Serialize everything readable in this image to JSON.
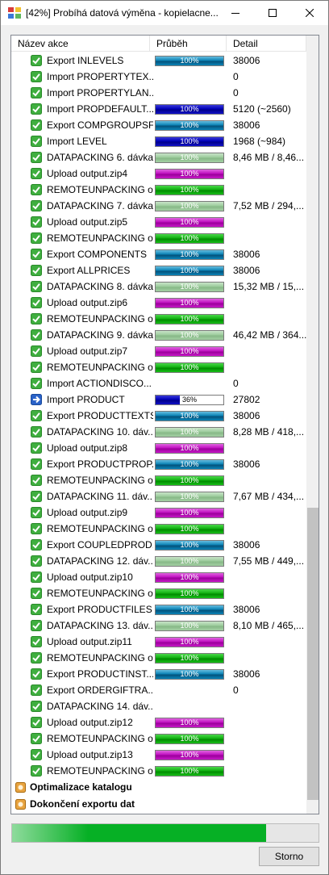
{
  "window": {
    "title": "[42%] Probíhá datová výměna - kopielacne..."
  },
  "columns": {
    "name": "Název akce",
    "progress": "Průběh",
    "detail": "Detail"
  },
  "rows": [
    {
      "name": "Export INLEVELS",
      "status": "done",
      "bar": {
        "pct": 1.0,
        "label": "100%",
        "color": "blue"
      },
      "detail": "38006"
    },
    {
      "name": "Import  PROPERTYTEX...",
      "status": "done",
      "bar": null,
      "detail": "0"
    },
    {
      "name": "Import PROPERTYLAN...",
      "status": "done",
      "bar": null,
      "detail": "0"
    },
    {
      "name": "Import PROPDEFAULT...",
      "status": "done",
      "bar": {
        "pct": 1.0,
        "label": "100%",
        "color": "navy"
      },
      "detail": "5120 (~2560)"
    },
    {
      "name": "Export COMPGROUPSF...",
      "status": "done",
      "bar": {
        "pct": 1.0,
        "label": "100%",
        "color": "blue"
      },
      "detail": "38006"
    },
    {
      "name": "Import LEVEL",
      "status": "done",
      "bar": {
        "pct": 1.0,
        "label": "100%",
        "color": "navy"
      },
      "detail": "1968 (~984)"
    },
    {
      "name": "DATAPACKING 6. dávka",
      "status": "done",
      "bar": {
        "pct": 1.0,
        "label": "100%",
        "color": "sage"
      },
      "detail": "8,46 MB / 8,46..."
    },
    {
      "name": "Upload output.zip4",
      "status": "done",
      "bar": {
        "pct": 1.0,
        "label": "100%",
        "color": "magenta"
      },
      "detail": ""
    },
    {
      "name": "REMOTEUNPACKING o...",
      "status": "done",
      "bar": {
        "pct": 1.0,
        "label": "100%",
        "color": "green"
      },
      "detail": ""
    },
    {
      "name": "DATAPACKING 7. dávka",
      "status": "done",
      "bar": {
        "pct": 1.0,
        "label": "100%",
        "color": "sage"
      },
      "detail": "7,52 MB / 294,..."
    },
    {
      "name": "Upload output.zip5",
      "status": "done",
      "bar": {
        "pct": 1.0,
        "label": "100%",
        "color": "magenta"
      },
      "detail": ""
    },
    {
      "name": "REMOTEUNPACKING o...",
      "status": "done",
      "bar": {
        "pct": 1.0,
        "label": "100%",
        "color": "green"
      },
      "detail": ""
    },
    {
      "name": "Export COMPONENTS",
      "status": "done",
      "bar": {
        "pct": 1.0,
        "label": "100%",
        "color": "blue"
      },
      "detail": "38006"
    },
    {
      "name": "Export ALLPRICES",
      "status": "done",
      "bar": {
        "pct": 1.0,
        "label": "100%",
        "color": "blue"
      },
      "detail": "38006"
    },
    {
      "name": "DATAPACKING 8. dávka",
      "status": "done",
      "bar": {
        "pct": 1.0,
        "label": "100%",
        "color": "sage"
      },
      "detail": "15,32 MB / 15,..."
    },
    {
      "name": "Upload output.zip6",
      "status": "done",
      "bar": {
        "pct": 1.0,
        "label": "100%",
        "color": "magenta"
      },
      "detail": ""
    },
    {
      "name": "REMOTEUNPACKING o...",
      "status": "done",
      "bar": {
        "pct": 1.0,
        "label": "100%",
        "color": "green"
      },
      "detail": ""
    },
    {
      "name": "DATAPACKING 9. dávka",
      "status": "done",
      "bar": {
        "pct": 1.0,
        "label": "100%",
        "color": "sage"
      },
      "detail": "46,42 MB / 364..."
    },
    {
      "name": "Upload output.zip7",
      "status": "done",
      "bar": {
        "pct": 1.0,
        "label": "100%",
        "color": "magenta"
      },
      "detail": ""
    },
    {
      "name": "REMOTEUNPACKING o...",
      "status": "done",
      "bar": {
        "pct": 1.0,
        "label": "100%",
        "color": "green"
      },
      "detail": ""
    },
    {
      "name": "Import ACTIONDISCO...",
      "status": "done",
      "bar": null,
      "detail": "0"
    },
    {
      "name": "Import PRODUCT",
      "status": "running",
      "bar": {
        "pct": 0.36,
        "label": "36%",
        "color": "navy"
      },
      "detail": "27802"
    },
    {
      "name": "Export PRODUCTTEXTS",
      "status": "done",
      "bar": {
        "pct": 1.0,
        "label": "100%",
        "color": "blue"
      },
      "detail": "38006"
    },
    {
      "name": "DATAPACKING 10. dáv...",
      "status": "done",
      "bar": {
        "pct": 1.0,
        "label": "100%",
        "color": "sage"
      },
      "detail": "8,28 MB / 418,..."
    },
    {
      "name": "Upload output.zip8",
      "status": "done",
      "bar": {
        "pct": 1.0,
        "label": "100%",
        "color": "magenta"
      },
      "detail": ""
    },
    {
      "name": "Export PRODUCTPROP...",
      "status": "done",
      "bar": {
        "pct": 1.0,
        "label": "100%",
        "color": "blue"
      },
      "detail": "38006"
    },
    {
      "name": "REMOTEUNPACKING o...",
      "status": "done",
      "bar": {
        "pct": 1.0,
        "label": "100%",
        "color": "green"
      },
      "detail": ""
    },
    {
      "name": "DATAPACKING 11. dáv...",
      "status": "done",
      "bar": {
        "pct": 1.0,
        "label": "100%",
        "color": "sage"
      },
      "detail": "7,67 MB / 434,..."
    },
    {
      "name": "Upload output.zip9",
      "status": "done",
      "bar": {
        "pct": 1.0,
        "label": "100%",
        "color": "magenta"
      },
      "detail": ""
    },
    {
      "name": "REMOTEUNPACKING o...",
      "status": "done",
      "bar": {
        "pct": 1.0,
        "label": "100%",
        "color": "green"
      },
      "detail": ""
    },
    {
      "name": "Export COUPLEDPROD...",
      "status": "done",
      "bar": {
        "pct": 1.0,
        "label": "100%",
        "color": "blue"
      },
      "detail": "38006"
    },
    {
      "name": "DATAPACKING 12. dáv...",
      "status": "done",
      "bar": {
        "pct": 1.0,
        "label": "100%",
        "color": "sage"
      },
      "detail": "7,55 MB / 449,..."
    },
    {
      "name": "Upload output.zip10",
      "status": "done",
      "bar": {
        "pct": 1.0,
        "label": "100%",
        "color": "magenta"
      },
      "detail": ""
    },
    {
      "name": "REMOTEUNPACKING o...",
      "status": "done",
      "bar": {
        "pct": 1.0,
        "label": "100%",
        "color": "green"
      },
      "detail": ""
    },
    {
      "name": "Export PRODUCTFILES",
      "status": "done",
      "bar": {
        "pct": 1.0,
        "label": "100%",
        "color": "blue"
      },
      "detail": "38006"
    },
    {
      "name": "DATAPACKING 13. dáv...",
      "status": "done",
      "bar": {
        "pct": 1.0,
        "label": "100%",
        "color": "sage"
      },
      "detail": "8,10 MB / 465,..."
    },
    {
      "name": "Upload output.zip11",
      "status": "done",
      "bar": {
        "pct": 1.0,
        "label": "100%",
        "color": "magenta"
      },
      "detail": ""
    },
    {
      "name": "REMOTEUNPACKING o...",
      "status": "done",
      "bar": {
        "pct": 1.0,
        "label": "100%",
        "color": "green"
      },
      "detail": ""
    },
    {
      "name": "Export PRODUCTINST...",
      "status": "done",
      "bar": {
        "pct": 1.0,
        "label": "100%",
        "color": "blue"
      },
      "detail": "38006"
    },
    {
      "name": "Export ORDERGIFTRA...",
      "status": "done",
      "bar": null,
      "detail": "0"
    },
    {
      "name": "DATAPACKING 14. dáv...",
      "status": "done",
      "bar": null,
      "detail": ""
    },
    {
      "name": "Upload output.zip12",
      "status": "done",
      "bar": {
        "pct": 1.0,
        "label": "100%",
        "color": "magenta"
      },
      "detail": ""
    },
    {
      "name": "REMOTEUNPACKING o...",
      "status": "done",
      "bar": {
        "pct": 1.0,
        "label": "100%",
        "color": "green"
      },
      "detail": ""
    },
    {
      "name": "Upload output.zip13",
      "status": "done",
      "bar": {
        "pct": 1.0,
        "label": "100%",
        "color": "magenta"
      },
      "detail": ""
    },
    {
      "name": "REMOTEUNPACKING o...",
      "status": "done",
      "bar": {
        "pct": 1.0,
        "label": "100%",
        "color": "green"
      },
      "detail": ""
    }
  ],
  "groups": [
    {
      "name": "Optimalizace katalogu"
    },
    {
      "name": "Dokončení exportu dat"
    }
  ],
  "overall_progress": {
    "fraction": 0.83,
    "color": "#06b025"
  },
  "cancel_button": {
    "label": "Storno"
  }
}
